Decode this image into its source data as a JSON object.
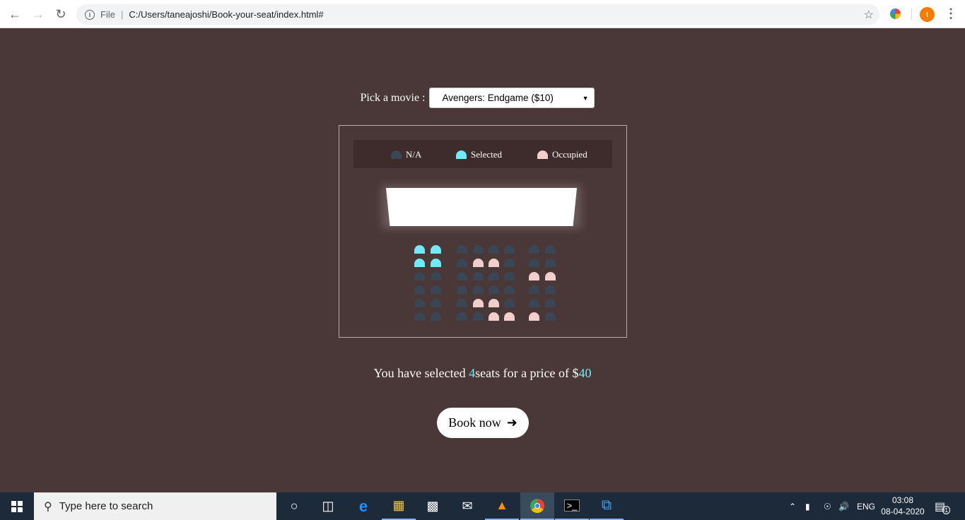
{
  "browser": {
    "scheme": "File",
    "url": "C:/Users/taneajoshi/Book-your-seat/index.html#",
    "profile_initial": "t"
  },
  "page": {
    "movie_label": "Pick a movie :",
    "movie_selected": "Avengers: Endgame ($10)",
    "legend": {
      "na": "N/A",
      "selected": "Selected",
      "occupied": "Occupied"
    },
    "summary": {
      "prefix": "You have selected ",
      "count": "4",
      "middle": "seats for a price of $",
      "total": "40"
    },
    "book_label": "Book now",
    "seats": [
      [
        "selected",
        "selected",
        "na",
        "na",
        "na",
        "na",
        "na",
        "na"
      ],
      [
        "selected",
        "selected",
        "na",
        "occupied",
        "occupied",
        "na",
        "na",
        "na"
      ],
      [
        "na",
        "na",
        "na",
        "na",
        "na",
        "na",
        "occupied",
        "occupied"
      ],
      [
        "na",
        "na",
        "na",
        "na",
        "na",
        "na",
        "na",
        "na"
      ],
      [
        "na",
        "na",
        "na",
        "occupied",
        "occupied",
        "na",
        "na",
        "na"
      ],
      [
        "na",
        "na",
        "na",
        "na",
        "occupied",
        "occupied",
        "occupied",
        "na"
      ]
    ]
  },
  "colors": {
    "background": "#4a3737",
    "seat_na": "#3b4654",
    "seat_selected": "#6feaf6",
    "seat_occupied": "#f0cfcd"
  },
  "taskbar": {
    "search_placeholder": "Type here to search",
    "language": "ENG",
    "time": "03:08",
    "date": "08-04-2020",
    "notification_count": "1",
    "apps": [
      "cortana-icon",
      "task-view-icon",
      "edge-icon",
      "file-explorer-icon",
      "store-icon",
      "mail-icon",
      "vlc-icon",
      "chrome-icon",
      "terminal-icon",
      "vscode-icon"
    ]
  }
}
